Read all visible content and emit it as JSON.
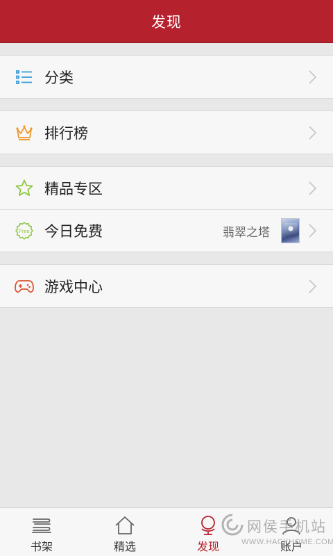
{
  "header": {
    "title": "发现"
  },
  "menu": {
    "category": {
      "label": "分类",
      "icon": "list-icon",
      "color": "#3a9bd8"
    },
    "ranking": {
      "label": "排行榜",
      "icon": "crown-icon",
      "color": "#f0972a"
    },
    "premium": {
      "label": "精品专区",
      "icon": "star-icon",
      "color": "#8cc63e"
    },
    "free_today": {
      "label": "今日免费",
      "icon": "free-badge-icon",
      "badge_text": "Free",
      "book_title": "翡翠之塔",
      "color": "#8cc63e"
    },
    "games": {
      "label": "游戏中心",
      "icon": "gamepad-icon",
      "color": "#e0512f"
    }
  },
  "tabbar": {
    "tabs": [
      {
        "label": "书架",
        "icon": "bookshelf-icon"
      },
      {
        "label": "精选",
        "icon": "home-icon"
      },
      {
        "label": "发现",
        "icon": "discover-icon",
        "active": true
      },
      {
        "label": "账户",
        "icon": "account-icon"
      }
    ],
    "active_color": "#b5212d"
  },
  "watermark": {
    "text": "网侯手机站",
    "url": "WWW.HACKHOME.COM"
  }
}
